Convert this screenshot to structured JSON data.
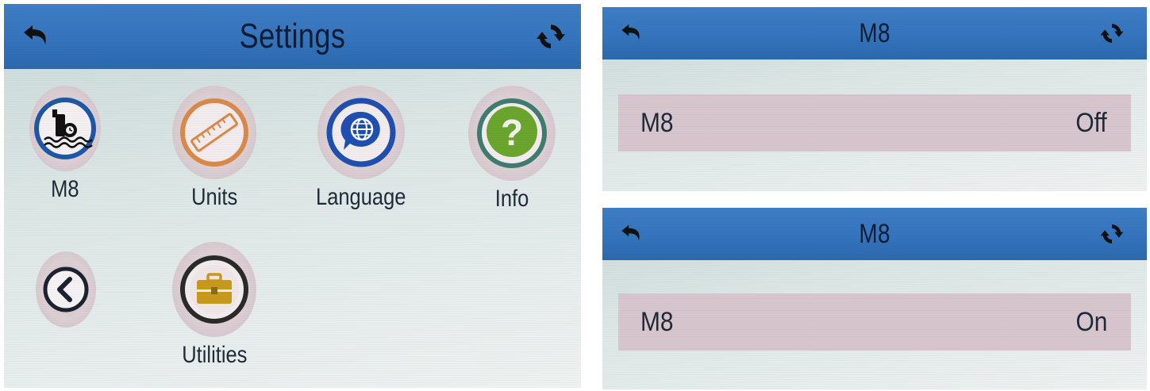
{
  "settings_screen": {
    "title": "Settings",
    "items": [
      {
        "label": "M8",
        "icon": "pump-clock-icon"
      },
      {
        "label": "Units",
        "icon": "ruler-icon"
      },
      {
        "label": "Language",
        "icon": "globe-chat-icon"
      },
      {
        "label": "Info",
        "icon": "question-icon"
      },
      {
        "label": "",
        "icon": "chevron-left-icon"
      },
      {
        "label": "Utilities",
        "icon": "toolbox-icon"
      }
    ],
    "header_icons": [
      "back-arrow-icon",
      "refresh-icon"
    ]
  },
  "m8_screen_off": {
    "title": "M8",
    "row": {
      "label": "M8",
      "value": "Off"
    }
  },
  "m8_screen_on": {
    "title": "M8",
    "row": {
      "label": "M8",
      "value": "On"
    }
  },
  "colors": {
    "titlebar": "#3474bd",
    "background": "#dde7e6",
    "row_highlight": "#d8c6ce",
    "text": "#1d2a38"
  }
}
